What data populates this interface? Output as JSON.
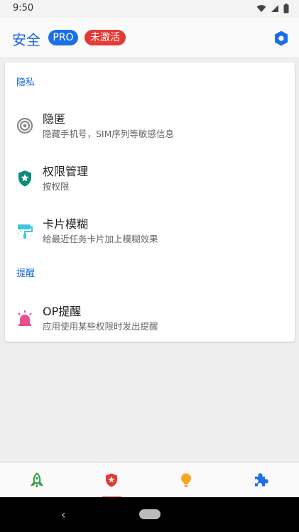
{
  "status_bar": {
    "time": "9:50"
  },
  "app_bar": {
    "title": "安全",
    "pro_badge": "PRO",
    "status_badge": "未激活",
    "settings_icon": "hexagon-settings-icon"
  },
  "sections": [
    {
      "header": "隐私",
      "items": [
        {
          "label": "隐匿",
          "subtitle": "隐藏手机号，SIM序列等敏感信息",
          "icon": "target-icon"
        },
        {
          "label": "权限管理",
          "subtitle": "按权限",
          "icon": "shield-star-icon"
        },
        {
          "label": "卡片模糊",
          "subtitle": "给最近任务卡片加上模糊效果",
          "icon": "paint-roller-icon"
        }
      ]
    },
    {
      "header": "提醒",
      "items": [
        {
          "label": "OP提醒",
          "subtitle": "应用使用某些权限时发出提醒",
          "icon": "alarm-light-icon"
        }
      ]
    }
  ],
  "bottom_nav": [
    {
      "icon": "rocket-icon",
      "color": "#2e9e3e",
      "selected": false
    },
    {
      "icon": "shield-star-icon",
      "color": "#e53935",
      "selected": true
    },
    {
      "icon": "lightbulb-icon",
      "color": "#f5a623",
      "selected": false
    },
    {
      "icon": "puzzle-icon",
      "color": "#1a6fe8",
      "selected": false
    }
  ],
  "colors": {
    "accent": "#1565e0",
    "pro": "#1a6fe8",
    "inactive": "#e53935",
    "shield_teal": "#0e8a78",
    "roller_cyan": "#3ec6dc",
    "alarm_pink": "#e84f8c"
  }
}
